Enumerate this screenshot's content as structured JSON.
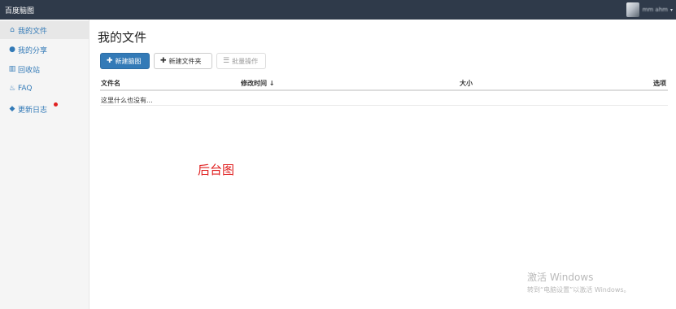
{
  "topbar": {
    "brand": "百度脑图",
    "user_name": "mm ahm"
  },
  "sidebar": {
    "items": [
      {
        "icon": "home-icon",
        "glyph": "⌂",
        "label": "我的文件",
        "active": true
      },
      {
        "icon": "globe-icon",
        "glyph": "●",
        "label": "我的分享",
        "active": false
      },
      {
        "icon": "trash-icon",
        "glyph": "▥",
        "label": "回收站",
        "active": false
      },
      {
        "icon": "fire-icon",
        "glyph": "♨",
        "label": "FAQ",
        "active": false
      },
      {
        "icon": "tags-icon",
        "glyph": "◆",
        "label": "更新日志",
        "active": false,
        "badge_color": "#e02020"
      }
    ]
  },
  "main": {
    "title": "我的文件",
    "buttons": {
      "new_mindmap": {
        "icon": "plus-icon",
        "label": "新建脑图"
      },
      "new_folder": {
        "icon": "plus-icon",
        "label": "新建文件夹"
      },
      "batch": {
        "icon": "list-icon",
        "label": "批量操作"
      }
    },
    "table": {
      "columns": {
        "name": "文件名",
        "mtime": "修改时间",
        "size": "大小",
        "options": "选项"
      },
      "sort_indicator": "↓",
      "empty_text": "这里什么也没有..."
    }
  },
  "annotation": {
    "text": "后台图",
    "color": "#e02020"
  },
  "watermark": {
    "title": "激活 Windows",
    "subtitle": "转到“电脑设置”以激活 Windows。"
  },
  "colors": {
    "topbar": "#2f3a4a",
    "primary": "#337ab7",
    "sidebar_bg": "#f5f5f5"
  }
}
